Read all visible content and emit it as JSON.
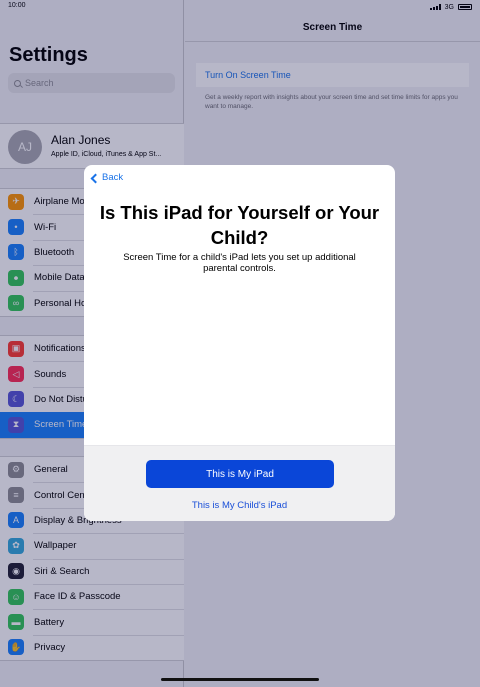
{
  "status_bar": {
    "time": "10:00",
    "network": "3G"
  },
  "sidebar": {
    "title": "Settings",
    "search_placeholder": "Search",
    "profile": {
      "initials": "AJ",
      "name": "Alan Jones",
      "subtitle": "Apple ID, iCloud, iTunes & App St..."
    },
    "group1": [
      {
        "label": "Airplane Mode",
        "icon": "airplane-icon",
        "color": "#ff9500"
      },
      {
        "label": "Wi-Fi",
        "icon": "wifi-icon",
        "color": "#1a82fb"
      },
      {
        "label": "Bluetooth",
        "icon": "bluetooth-icon",
        "color": "#1a82fb"
      },
      {
        "label": "Mobile Data",
        "icon": "antenna-icon",
        "color": "#34c759"
      },
      {
        "label": "Personal Hotspot",
        "icon": "hotspot-icon",
        "color": "#34c759"
      }
    ],
    "group2": [
      {
        "label": "Notifications",
        "icon": "notifications-icon",
        "color": "#ff3b30"
      },
      {
        "label": "Sounds",
        "icon": "speaker-icon",
        "color": "#ff2d55"
      },
      {
        "label": "Do Not Disturb",
        "icon": "moon-icon",
        "color": "#5856d6"
      },
      {
        "label": "Screen Time",
        "icon": "hourglass-icon",
        "color": "#5856d6",
        "selected": true
      }
    ],
    "group3": [
      {
        "label": "General",
        "icon": "gear-icon",
        "color": "#8e8e93"
      },
      {
        "label": "Control Centre",
        "icon": "switches-icon",
        "color": "#8e8e93"
      },
      {
        "label": "Display & Brightness",
        "icon": "text-size-icon",
        "color": "#1a82fb"
      },
      {
        "label": "Wallpaper",
        "icon": "flower-icon",
        "color": "#34aadc"
      },
      {
        "label": "Siri & Search",
        "icon": "siri-icon",
        "color": "#222233"
      },
      {
        "label": "Face ID & Passcode",
        "icon": "face-id-icon",
        "color": "#34c759"
      },
      {
        "label": "Battery",
        "icon": "battery-icon",
        "color": "#34c759"
      },
      {
        "label": "Privacy",
        "icon": "hand-icon",
        "color": "#1a82fb"
      }
    ]
  },
  "detail": {
    "title": "Screen Time",
    "turn_on_label": "Turn On Screen Time",
    "description": "Get a weekly report with insights about your screen time and set time limits for apps you want to manage."
  },
  "modal": {
    "back_label": "Back",
    "title": "Is This iPad for Yourself or Your Child?",
    "subtitle": "Screen Time for a child's iPad lets you set up additional parental controls.",
    "primary_label": "This is My iPad",
    "secondary_label": "This is My Child's iPad"
  }
}
